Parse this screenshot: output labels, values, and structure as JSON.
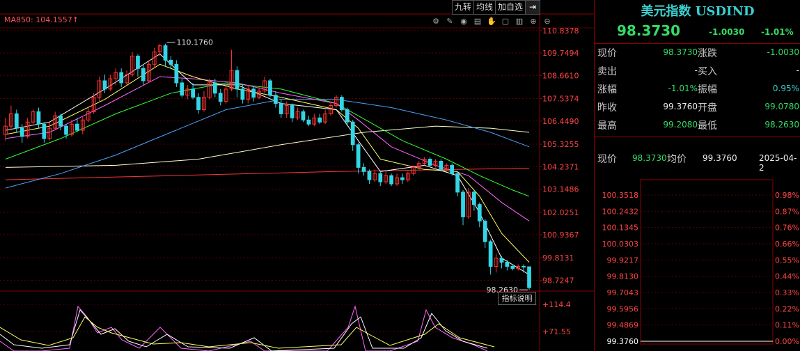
{
  "toolbar": {
    "nine_turn": "九转",
    "avg_line": "均线",
    "add_watch": "加自选",
    "exit_icon": "exit-icon"
  },
  "tool_icons": [
    "gear-icon",
    "pen-icon",
    "eye-icon",
    "trash-icon",
    "hand-icon",
    "lock-icon",
    "delete-icon",
    "zoom-in-icon",
    "zoom-out-icon"
  ],
  "ma_label": "MA850: 104.1557↑",
  "indicator_button": "指标说明",
  "chart_data": {
    "type": "candlestick",
    "y_ticks": [
      "110.8378",
      "109.7494",
      "108.6610",
      "107.5374",
      "106.4490",
      "105.3255",
      "104.2371",
      "103.1486",
      "102.0251",
      "100.9367",
      "99.8131",
      "98.7247"
    ],
    "ylim": [
      98.2,
      110.9
    ],
    "high_label": "110.1760",
    "low_label": "98.2630",
    "ma850_value": 104.1557,
    "indicator_ticks": [
      "114.4",
      "71.55"
    ],
    "colors": {
      "up": "#ff3333",
      "down": "#33d6e6",
      "ma5": "#ffffff",
      "ma10": "#ffff66",
      "ma20": "#ff66ff",
      "ma60": "#33ff33",
      "ma120": "#4aa3ff",
      "ma250": "#ffffcc",
      "ma850": "#ff3333"
    },
    "candles": [
      [
        105.8,
        106.2,
        105.5,
        106.6
      ],
      [
        106.2,
        106.8,
        106.0,
        107.2
      ],
      [
        106.8,
        106.1,
        105.9,
        107.0
      ],
      [
        106.1,
        105.7,
        105.4,
        106.3
      ],
      [
        105.7,
        106.4,
        105.6,
        106.6
      ],
      [
        106.4,
        106.9,
        106.3,
        107.0
      ],
      [
        106.9,
        106.3,
        106.1,
        107.1
      ],
      [
        106.3,
        105.6,
        105.4,
        106.4
      ],
      [
        105.6,
        106.1,
        105.5,
        106.4
      ],
      [
        106.1,
        106.7,
        106.0,
        106.9
      ],
      [
        106.7,
        106.2,
        106.0,
        106.8
      ],
      [
        106.2,
        105.8,
        105.6,
        106.3
      ],
      [
        105.8,
        106.3,
        105.7,
        106.5
      ],
      [
        106.3,
        106.0,
        105.9,
        106.6
      ],
      [
        106.0,
        106.5,
        105.8,
        106.7
      ],
      [
        106.5,
        106.9,
        106.4,
        107.1
      ],
      [
        106.9,
        107.6,
        106.8,
        107.8
      ],
      [
        107.6,
        108.4,
        107.4,
        108.6
      ],
      [
        108.4,
        108.0,
        107.8,
        108.7
      ],
      [
        108.0,
        108.5,
        107.9,
        108.7
      ],
      [
        108.5,
        108.8,
        108.2,
        109.0
      ],
      [
        108.8,
        108.3,
        108.1,
        109.0
      ],
      [
        108.3,
        108.7,
        108.2,
        108.9
      ],
      [
        108.7,
        109.6,
        108.6,
        109.8
      ],
      [
        109.6,
        109.0,
        108.6,
        109.7
      ],
      [
        109.0,
        108.4,
        108.2,
        109.2
      ],
      [
        108.4,
        109.2,
        108.3,
        109.4
      ],
      [
        109.2,
        109.8,
        109.0,
        110.0
      ],
      [
        109.8,
        110.1,
        109.6,
        110.18
      ],
      [
        110.1,
        109.4,
        109.1,
        110.2
      ],
      [
        109.4,
        109.2,
        109.0,
        109.6
      ],
      [
        109.2,
        108.3,
        108.1,
        109.4
      ],
      [
        108.3,
        107.7,
        107.6,
        108.5
      ],
      [
        107.7,
        108.0,
        107.5,
        108.2
      ],
      [
        108.0,
        107.6,
        107.5,
        108.3
      ],
      [
        107.6,
        107.0,
        106.8,
        107.8
      ],
      [
        107.0,
        107.6,
        106.9,
        107.9
      ],
      [
        107.6,
        108.3,
        107.5,
        108.5
      ],
      [
        108.3,
        107.8,
        107.6,
        108.5
      ],
      [
        107.8,
        107.4,
        107.2,
        108.0
      ],
      [
        107.4,
        108.0,
        107.3,
        108.2
      ],
      [
        108.0,
        108.9,
        107.9,
        109.9
      ],
      [
        108.9,
        108.0,
        107.6,
        109.1
      ],
      [
        108.0,
        107.5,
        107.3,
        108.2
      ],
      [
        107.5,
        108.0,
        107.3,
        108.2
      ],
      [
        108.0,
        107.6,
        107.4,
        108.1
      ],
      [
        107.6,
        107.9,
        107.5,
        108.1
      ],
      [
        107.9,
        108.4,
        107.8,
        108.6
      ],
      [
        108.4,
        107.7,
        107.6,
        108.5
      ],
      [
        107.7,
        107.3,
        107.1,
        107.9
      ],
      [
        107.3,
        106.8,
        106.6,
        107.5
      ],
      [
        106.8,
        107.2,
        106.6,
        107.4
      ],
      [
        107.2,
        106.6,
        106.4,
        107.3
      ],
      [
        106.6,
        106.9,
        106.5,
        107.1
      ],
      [
        106.9,
        106.5,
        106.4,
        107.0
      ],
      [
        106.5,
        106.3,
        106.2,
        106.7
      ],
      [
        106.3,
        106.6,
        106.2,
        106.8
      ],
      [
        106.6,
        106.4,
        106.3,
        106.8
      ],
      [
        106.4,
        106.8,
        106.3,
        107.0
      ],
      [
        106.8,
        107.2,
        106.7,
        107.4
      ],
      [
        107.2,
        107.6,
        107.1,
        107.7
      ],
      [
        107.6,
        107.0,
        106.9,
        107.7
      ],
      [
        107.0,
        106.4,
        106.2,
        107.1
      ],
      [
        106.4,
        105.3,
        105.0,
        106.5
      ],
      [
        105.3,
        104.2,
        103.9,
        105.4
      ],
      [
        104.2,
        104.0,
        103.8,
        104.4
      ],
      [
        104.0,
        103.6,
        103.4,
        104.1
      ],
      [
        103.6,
        103.9,
        103.5,
        104.1
      ],
      [
        103.9,
        103.5,
        103.3,
        104.0
      ],
      [
        103.5,
        103.8,
        103.4,
        104.0
      ],
      [
        103.8,
        103.4,
        103.3,
        103.9
      ],
      [
        103.4,
        103.7,
        103.3,
        103.9
      ],
      [
        103.7,
        103.6,
        103.4,
        103.9
      ],
      [
        103.6,
        103.9,
        103.5,
        104.0
      ],
      [
        103.9,
        104.2,
        103.8,
        104.3
      ],
      [
        104.2,
        104.4,
        104.1,
        104.5
      ],
      [
        104.4,
        104.6,
        104.3,
        104.7
      ],
      [
        104.6,
        104.3,
        104.2,
        104.7
      ],
      [
        104.3,
        104.5,
        104.2,
        104.6
      ],
      [
        104.5,
        104.1,
        104.0,
        104.6
      ],
      [
        104.1,
        104.3,
        104.0,
        104.4
      ],
      [
        104.3,
        103.9,
        103.8,
        104.4
      ],
      [
        103.9,
        103.0,
        102.8,
        104.0
      ],
      [
        103.0,
        101.8,
        101.4,
        103.1
      ],
      [
        101.8,
        103.0,
        101.7,
        103.2
      ],
      [
        103.0,
        102.4,
        102.1,
        103.1
      ],
      [
        102.4,
        101.6,
        101.3,
        102.5
      ],
      [
        101.6,
        100.6,
        100.3,
        101.7
      ],
      [
        100.6,
        99.4,
        99.0,
        100.7
      ],
      [
        99.4,
        99.8,
        99.1,
        100.0
      ],
      [
        99.8,
        99.6,
        99.3,
        99.9
      ],
      [
        99.6,
        99.4,
        99.2,
        99.7
      ],
      [
        99.4,
        99.3,
        99.2,
        99.5
      ],
      [
        99.3,
        99.4,
        99.2,
        99.5
      ],
      [
        99.4,
        99.38,
        99.1,
        99.5
      ],
      [
        99.38,
        98.37,
        98.263,
        99.38
      ]
    ],
    "ma_series": {
      "ma5": [
        [
          0,
          106.0
        ],
        [
          8,
          106.4
        ],
        [
          18,
          108.0
        ],
        [
          28,
          109.7
        ],
        [
          34,
          108.2
        ],
        [
          42,
          108.2
        ],
        [
          50,
          107.3
        ],
        [
          60,
          107.0
        ],
        [
          64,
          105.5
        ],
        [
          68,
          104.0
        ],
        [
          76,
          104.3
        ],
        [
          82,
          103.8
        ],
        [
          86,
          102.0
        ],
        [
          90,
          99.8
        ],
        [
          95,
          99.0
        ]
      ],
      "ma10": [
        [
          0,
          105.8
        ],
        [
          8,
          106.2
        ],
        [
          18,
          107.5
        ],
        [
          28,
          109.2
        ],
        [
          34,
          108.6
        ],
        [
          42,
          108.0
        ],
        [
          50,
          107.6
        ],
        [
          60,
          107.0
        ],
        [
          64,
          106.1
        ],
        [
          68,
          104.6
        ],
        [
          76,
          104.1
        ],
        [
          82,
          104.0
        ],
        [
          86,
          102.8
        ],
        [
          90,
          101.0
        ],
        [
          95,
          99.6
        ]
      ],
      "ma20": [
        [
          0,
          105.6
        ],
        [
          8,
          105.9
        ],
        [
          18,
          107.2
        ],
        [
          28,
          108.6
        ],
        [
          34,
          108.5
        ],
        [
          42,
          108.3
        ],
        [
          50,
          107.8
        ],
        [
          60,
          107.3
        ],
        [
          64,
          106.5
        ],
        [
          70,
          105.2
        ],
        [
          78,
          104.3
        ],
        [
          84,
          103.8
        ],
        [
          90,
          102.5
        ],
        [
          95,
          101.6
        ]
      ],
      "ma60": [
        [
          0,
          104.6
        ],
        [
          10,
          105.6
        ],
        [
          20,
          106.8
        ],
        [
          30,
          107.8
        ],
        [
          40,
          108.3
        ],
        [
          50,
          108.0
        ],
        [
          60,
          107.3
        ],
        [
          66,
          106.4
        ],
        [
          72,
          105.5
        ],
        [
          80,
          104.6
        ],
        [
          86,
          103.8
        ],
        [
          92,
          103.1
        ],
        [
          95,
          102.8
        ]
      ],
      "ma120": [
        [
          0,
          103.2
        ],
        [
          10,
          103.9
        ],
        [
          20,
          104.8
        ],
        [
          30,
          105.9
        ],
        [
          40,
          107.0
        ],
        [
          50,
          107.5
        ],
        [
          60,
          107.5
        ],
        [
          70,
          107.1
        ],
        [
          80,
          106.5
        ],
        [
          88,
          105.9
        ],
        [
          95,
          105.2
        ]
      ],
      "ma250": [
        [
          0,
          104.2
        ],
        [
          20,
          104.3
        ],
        [
          35,
          104.6
        ],
        [
          50,
          105.3
        ],
        [
          65,
          105.9
        ],
        [
          78,
          106.2
        ],
        [
          88,
          106.1
        ],
        [
          95,
          105.9
        ]
      ],
      "ma850": [
        [
          0,
          103.6
        ],
        [
          30,
          103.8
        ],
        [
          60,
          104.0
        ],
        [
          95,
          104.16
        ]
      ]
    }
  },
  "panel": {
    "title": "美元指数 USDIND",
    "price": "98.3730",
    "change": "-1.0030",
    "change_pct": "-1.01%",
    "rows": [
      {
        "l1": "现价",
        "v1": "98.3730",
        "c1": "green",
        "l2": "涨跌",
        "v2": "-1.0030",
        "c2": "green"
      },
      {
        "l1": "卖出",
        "v1": "-",
        "c1": "white",
        "l2": "买入",
        "v2": "-",
        "c2": "white"
      },
      {
        "l1": "涨幅",
        "v1": "-1.01%",
        "c1": "green",
        "l2": "振幅",
        "v2": "0.95%",
        "c2": "cyan"
      },
      {
        "l1": "昨收",
        "v1": "99.3760",
        "c1": "white",
        "l2": "开盘",
        "v2": "99.0780",
        "c2": "green"
      },
      {
        "l1": "最高",
        "v1": "99.2080",
        "c1": "green",
        "l2": "最低",
        "v2": "98.2630",
        "c2": "green"
      }
    ],
    "info": {
      "now_label": "现价",
      "now_value": "98.3730",
      "avg_label": "均价",
      "avg_value": "99.3760",
      "date": "2025-04-2"
    },
    "mini_left_ticks": [
      "100.3518",
      "100.2432",
      "100.1345",
      "100.0303",
      "99.9217",
      "99.8130",
      "99.7043",
      "99.5956",
      "99.4869"
    ],
    "mini_right_ticks": [
      "0.98%",
      "0.87%",
      "0.76%",
      "0.66%",
      "0.55%",
      "0.44%",
      "0.33%",
      "0.22%",
      "0.11%",
      "0.00%"
    ],
    "mini_bottom_label": "99.3760"
  }
}
